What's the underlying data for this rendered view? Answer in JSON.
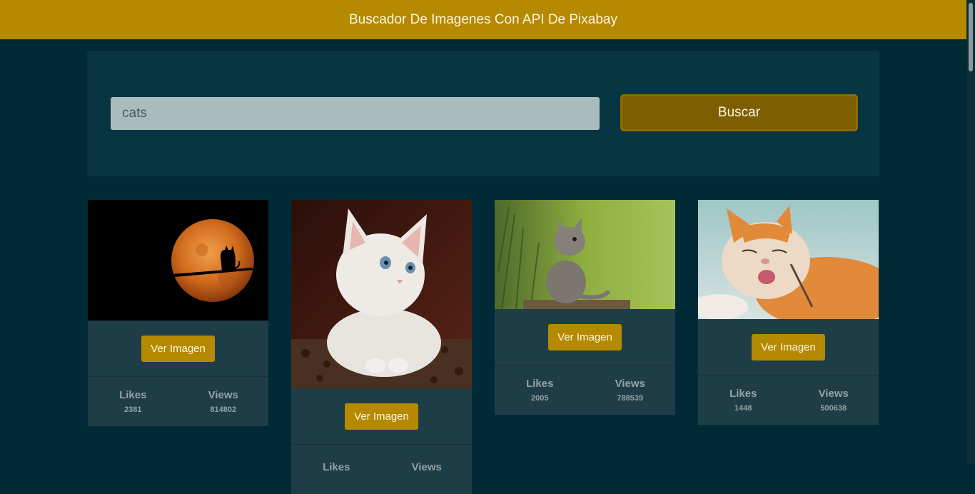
{
  "header": {
    "title": "Buscador De Imagenes Con API De Pixabay"
  },
  "search": {
    "value": "cats",
    "button_label": "Buscar"
  },
  "results": [
    {
      "image_icon": "moon-cat-photo",
      "button_label": "Ver Imagen",
      "likes_label": "Likes",
      "likes": "2381",
      "views_label": "Views",
      "views": "814802"
    },
    {
      "image_icon": "white-kitten-photo",
      "button_label": "Ver Imagen",
      "likes_label": "Likes",
      "likes": "",
      "views_label": "Views",
      "views": ""
    },
    {
      "image_icon": "grey-kitten-photo",
      "button_label": "Ver Imagen",
      "likes_label": "Likes",
      "likes": "2005",
      "views_label": "Views",
      "views": "788539"
    },
    {
      "image_icon": "orange-cat-photo",
      "button_label": "Ver Imagen",
      "likes_label": "Likes",
      "likes": "1448",
      "views_label": "Views",
      "views": "500638"
    }
  ],
  "colors": {
    "accent": "#b58900",
    "background": "#002b36",
    "panel": "#073642",
    "card": "#1e3d47"
  }
}
